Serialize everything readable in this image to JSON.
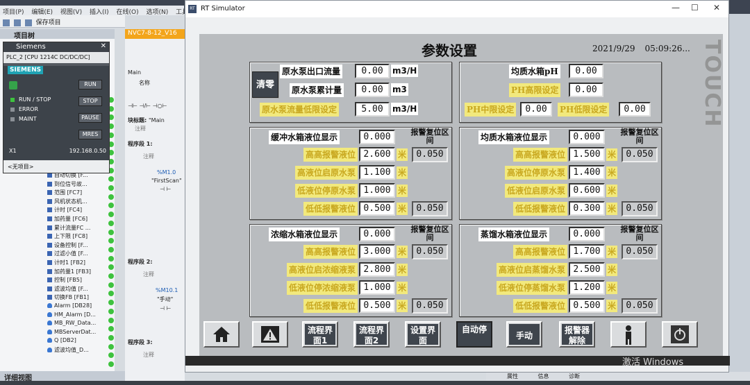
{
  "tia": {
    "menu": [
      "项目(P)",
      "编辑(E)",
      "视图(V)",
      "插入(I)",
      "在线(O)",
      "选项(N)",
      "工具"
    ],
    "save_project": "保存项目",
    "project_tree": "项目树",
    "editor_tab": "NVC7-8-12_V16",
    "main_label": "Main",
    "name_col": "名称",
    "block_title": "块标题:",
    "main_quote": "\"Main",
    "comment": "注释",
    "seg1": "程序段 1:",
    "seg2": "程序段 2:",
    "seg3": "程序段 3:",
    "tag1_addr": "%M1.0",
    "tag1_name": "\"FirstScan\"",
    "tag2_addr": "%M10.1",
    "tag2_name": "\"手动\"",
    "detail_view": "详细视图",
    "bottom_tabs": [
      "属性",
      "信息",
      "诊断"
    ],
    "tree_items": [
      {
        "label": "自动切换 [F...",
        "type": "fc"
      },
      {
        "label": "到位信号故...",
        "type": "fc"
      },
      {
        "label": "范围 [FC7]",
        "type": "fc"
      },
      {
        "label": "风机状态机...",
        "type": "fc"
      },
      {
        "label": "计时 [FC4]",
        "type": "fc"
      },
      {
        "label": "加药量 [FC6]",
        "type": "fc"
      },
      {
        "label": "累计流量FC ...",
        "type": "fc"
      },
      {
        "label": "上下限 [FC8]",
        "type": "fc"
      },
      {
        "label": "设备控制 [F...",
        "type": "fc"
      },
      {
        "label": "过滤小值 [F...",
        "type": "fc"
      },
      {
        "label": "计时1 [FB2]",
        "type": "fc"
      },
      {
        "label": "加药量1 [FB3]",
        "type": "fc"
      },
      {
        "label": "控制 [FB5]",
        "type": "fc"
      },
      {
        "label": "滤波均值 [F...",
        "type": "fc"
      },
      {
        "label": "切换FB [FB1]",
        "type": "fc"
      },
      {
        "label": "Alarm [DB28]",
        "type": "db"
      },
      {
        "label": "HM_Alarm [D...",
        "type": "db"
      },
      {
        "label": "MB_RW_Data...",
        "type": "db"
      },
      {
        "label": "MBServerDat...",
        "type": "db"
      },
      {
        "label": "Q [DB2]",
        "type": "db"
      },
      {
        "label": "滤波均值_D...",
        "type": "db"
      }
    ]
  },
  "plc": {
    "title": "Siemens",
    "model": "PLC_2 [CPU 1214C DC/DC/DC]",
    "brand": "SIEMENS",
    "leds": [
      "RUN / STOP",
      "ERROR",
      "MAINT"
    ],
    "buttons": [
      "RUN",
      "STOP",
      "PAUSE",
      "MRES"
    ],
    "slot": "X1",
    "ip": "192.168.0.50",
    "footer": "<无项目>"
  },
  "rt": {
    "window_title": "RT Simulator",
    "page_title": "参数设置",
    "date": "2021/9/29",
    "time": "05:09:26...",
    "touch": "TOUCH",
    "clear": "清零",
    "raw": {
      "flow_label": "原水泵出口流量",
      "flow_value": "0.00",
      "flow_unit": "m3/H",
      "total_label": "原水泵累计量",
      "total_value": "0.00",
      "total_unit": "m3",
      "lowflow_label": "原水泵流量低限设定",
      "lowflow_value": "5.00",
      "lowflow_unit": "m3/H"
    },
    "ph": {
      "ph_label": "均质水箱pH",
      "ph_value": "0.00",
      "high_label": "PH高限设定",
      "high_value": "0.00",
      "mid_label": "PH中限设定",
      "mid_value": "0.00",
      "low_label": "PH低限设定",
      "low_value": "0.00"
    },
    "reset_header": "报警复位区间",
    "unit_m": "米",
    "tanks": {
      "buffer": {
        "title": "缓冲水箱液位显示",
        "level": "0.000",
        "rows": [
          {
            "label": "高高报警液位",
            "value": "2.600",
            "reset": "0.050"
          },
          {
            "label": "高液位启原水泵",
            "value": "1.100",
            "reset": ""
          },
          {
            "label": "低液位停原水泵",
            "value": "1.000",
            "reset": ""
          },
          {
            "label": "低低报警液位",
            "value": "0.500",
            "reset": "0.050"
          }
        ]
      },
      "homo": {
        "title": "均质水箱液位显示",
        "level": "0.000",
        "rows": [
          {
            "label": "高高报警液位",
            "value": "1.500",
            "reset": "0.050"
          },
          {
            "label": "高液位停原水泵",
            "value": "1.400",
            "reset": ""
          },
          {
            "label": "低液位启原水泵",
            "value": "0.600",
            "reset": ""
          },
          {
            "label": "低低报警液位",
            "value": "0.300",
            "reset": "0.050"
          }
        ]
      },
      "conc": {
        "title": "浓缩水箱液位显示",
        "level": "0.000",
        "rows": [
          {
            "label": "高高报警液位",
            "value": "3.000",
            "reset": "0.050"
          },
          {
            "label": "高液位启浓缩液泵",
            "value": "2.800",
            "reset": ""
          },
          {
            "label": "低液位停浓缩液泵",
            "value": "1.000",
            "reset": ""
          },
          {
            "label": "低低报警液位",
            "value": "0.500",
            "reset": "0.050"
          }
        ]
      },
      "dist": {
        "title": "蒸馏水箱液位显示",
        "level": "0.000",
        "rows": [
          {
            "label": "高高报警液位",
            "value": "1.700",
            "reset": "0.050"
          },
          {
            "label": "高液位启蒸馏水泵",
            "value": "2.500",
            "reset": ""
          },
          {
            "label": "低液位停蒸馏水泵",
            "value": "1.200",
            "reset": ""
          },
          {
            "label": "低低报警液位",
            "value": "0.500",
            "reset": "0.050"
          }
        ]
      }
    },
    "nav": [
      {
        "label": "",
        "icon": "home-icon"
      },
      {
        "label": "",
        "icon": "alarm-icon"
      },
      {
        "label": "流程界面1"
      },
      {
        "label": "流程界面2"
      },
      {
        "label": "设置界面"
      },
      {
        "label": "自动停"
      },
      {
        "label": "手动"
      },
      {
        "label": "报警器解除"
      },
      {
        "label": "",
        "icon": "person-icon"
      },
      {
        "label": "",
        "icon": "power-icon"
      }
    ],
    "watermark": "激活 Windows"
  },
  "colors": {
    "hmi_bg": "#b9bcbf",
    "label_yellow": "#f2e97d",
    "label_yellow_text": "#c9a820",
    "plc_green": "#3ec23e",
    "editor_orange": "#f3a51b"
  }
}
